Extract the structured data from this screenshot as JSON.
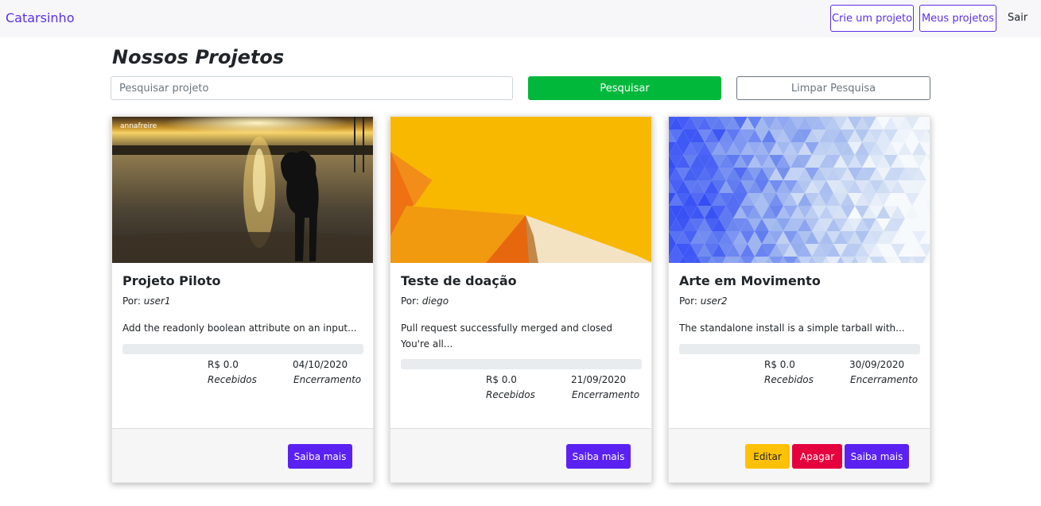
{
  "navbar": {
    "brand": "Catarsinho",
    "create_label": "Crie um projeto",
    "mine_label": "Meus projetos",
    "logout_label": "Sair"
  },
  "page": {
    "title": "Nossos Projetos"
  },
  "search": {
    "placeholder": "Pesquisar projeto",
    "value": "",
    "button_label": "Pesquisar",
    "clear_label": "Limpar Pesquisa"
  },
  "cards": [
    {
      "title": "Projeto Piloto",
      "author_prefix": "Por:",
      "author": "user1",
      "description": "Add the readonly boolean attribute on an input...",
      "progress": 0,
      "amount": "R$ 0.0",
      "amount_label": "Recebidos",
      "end_date": "04/10/2020",
      "end_label": "Encerramento",
      "watermark": "annafreire",
      "more_label": "Saiba mais"
    },
    {
      "title": "Teste de doação",
      "author_prefix": "Por:",
      "author": "diego",
      "description": "Pull request successfully merged and closed You're all...",
      "progress": 0,
      "amount": "R$ 0.0",
      "amount_label": "Recebidos",
      "end_date": "21/09/2020",
      "end_label": "Encerramento",
      "more_label": "Saiba mais"
    },
    {
      "title": "Arte em Movimento",
      "author_prefix": "Por:",
      "author": "user2",
      "description": "The standalone install is a simple tarball with...",
      "progress": 0,
      "amount": "R$ 0.0",
      "amount_label": "Recebidos",
      "end_date": "30/09/2020",
      "end_label": "Encerramento",
      "edit_label": "Editar",
      "delete_label": "Apagar",
      "more_label": "Saiba mais"
    }
  ],
  "colors": {
    "brand": "#5b2ee6",
    "search_button": "#02b83b",
    "more_button": "#5b21f3",
    "edit_button": "#ffc107",
    "delete_button": "#e4003d"
  }
}
